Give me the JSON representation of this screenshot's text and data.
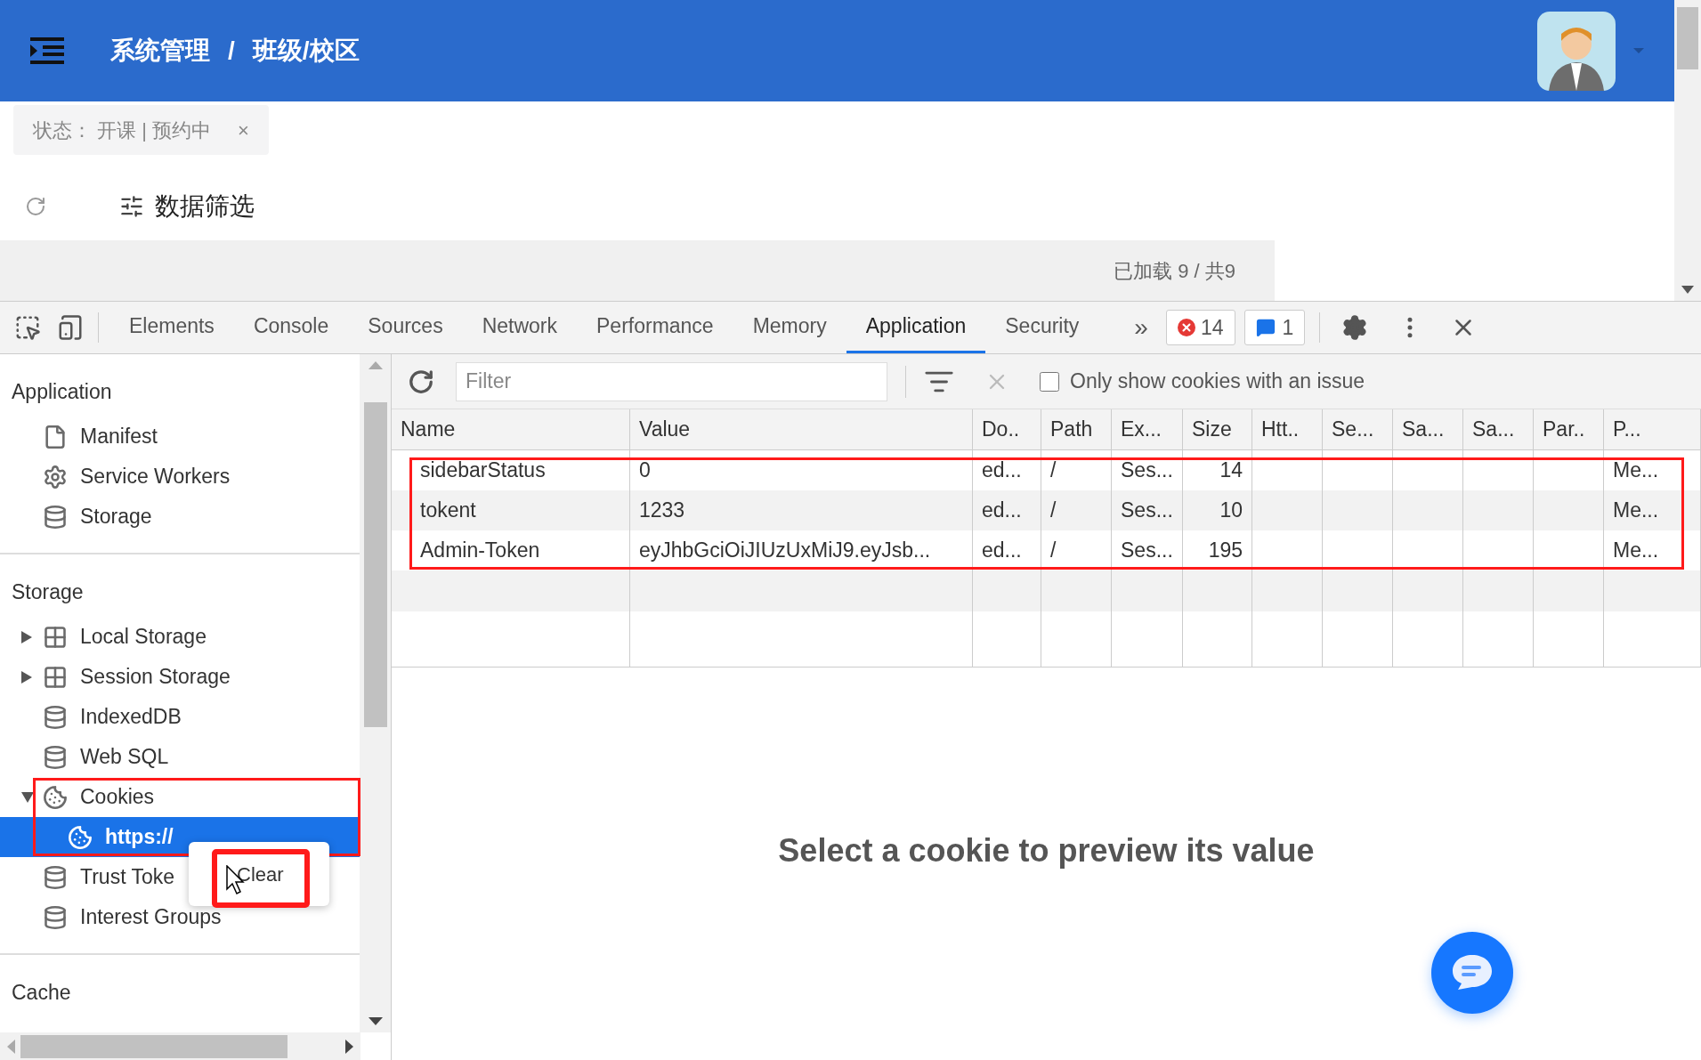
{
  "header": {
    "breadcrumb": [
      "系统管理",
      "班级/校区"
    ],
    "separator": "/"
  },
  "filter_tag": {
    "label": "状态：  开课 | 预约中",
    "close": "×"
  },
  "page_toolbar": {
    "title": "数据筛选"
  },
  "table_status": "已加载 9 / 共9",
  "devtools": {
    "tabs": [
      {
        "label": "Elements",
        "selected": false
      },
      {
        "label": "Console",
        "selected": false
      },
      {
        "label": "Sources",
        "selected": false
      },
      {
        "label": "Network",
        "selected": false
      },
      {
        "label": "Performance",
        "selected": false
      },
      {
        "label": "Memory",
        "selected": false
      },
      {
        "label": "Application",
        "selected": true
      },
      {
        "label": "Security",
        "selected": false
      }
    ],
    "more": "»",
    "errors": "14",
    "messages": "1"
  },
  "sidebar": {
    "sections": [
      {
        "title": "Application",
        "items": [
          {
            "label": "Manifest",
            "kind": "file",
            "selected": false
          },
          {
            "label": "Service Workers",
            "kind": "gear",
            "selected": false
          },
          {
            "label": "Storage",
            "kind": "database",
            "selected": false
          }
        ]
      },
      {
        "title": "Storage",
        "items": [
          {
            "label": "Local Storage",
            "kind": "grid",
            "expanded": false,
            "selected": false
          },
          {
            "label": "Session Storage",
            "kind": "grid",
            "expanded": false,
            "selected": false
          },
          {
            "label": "IndexedDB",
            "kind": "database",
            "selected": false
          },
          {
            "label": "Web SQL",
            "kind": "database",
            "selected": false
          },
          {
            "label": "Cookies",
            "kind": "cookie",
            "expanded": true,
            "selected": false,
            "children": [
              {
                "label": "https://",
                "kind": "cookie",
                "selected": true
              }
            ]
          },
          {
            "label": "Trust Toke",
            "kind": "database",
            "selected": false
          },
          {
            "label": "Interest Groups",
            "kind": "database",
            "selected": false
          }
        ]
      },
      {
        "title": "Cache"
      }
    ]
  },
  "context_menu": {
    "items": [
      "Clear"
    ]
  },
  "cookies": {
    "filter_placeholder": "Filter",
    "only_issues": {
      "label": "Only show cookies with an issue",
      "checked": false
    },
    "columns": [
      "Name",
      "Value",
      "Do..",
      "Path",
      "Ex...",
      "Size",
      "Htt..",
      "Se...",
      "Sa...",
      "Sa...",
      "Par..",
      "P..."
    ],
    "rows": [
      [
        "sidebarStatus",
        "0",
        "ed...",
        "/",
        "Ses...",
        "14",
        "",
        "",
        "",
        "",
        "",
        "Me..."
      ],
      [
        "tokent",
        "1233",
        "ed...",
        "/",
        "Ses...",
        "10",
        "",
        "",
        "",
        "",
        "",
        "Me..."
      ],
      [
        "Admin-Token",
        "eyJhbGciOiJIUzUxMiJ9.eyJsb...",
        "ed...",
        "/",
        "Ses...",
        "195",
        "",
        "",
        "",
        "",
        "",
        "Me..."
      ]
    ]
  },
  "preview_message": "Select a cookie to preview its value"
}
